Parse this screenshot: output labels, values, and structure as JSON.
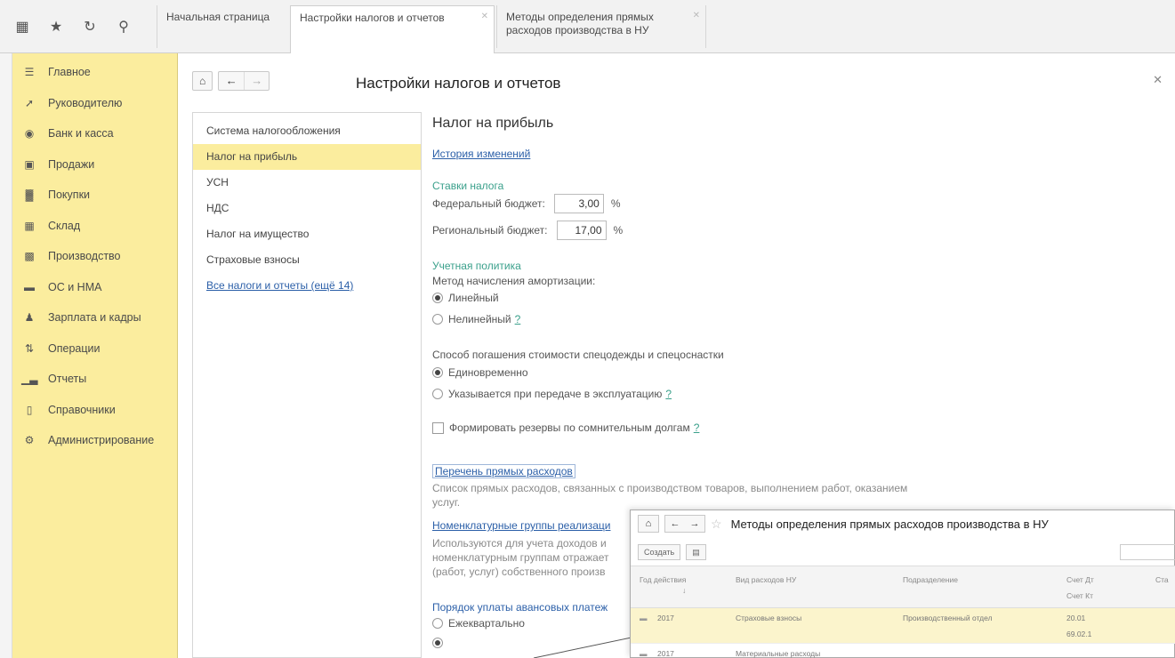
{
  "tabs": [
    {
      "label": "Начальная страница"
    },
    {
      "label": "Настройки налогов и отчетов"
    },
    {
      "label": "Методы определения прямых расходов производства в НУ"
    }
  ],
  "sidebar": {
    "items": [
      {
        "label": "Главное",
        "icon": "menu-icon"
      },
      {
        "label": "Руководителю",
        "icon": "chart-line-icon"
      },
      {
        "label": "Банк и касса",
        "icon": "coin-icon"
      },
      {
        "label": "Продажи",
        "icon": "bag-icon"
      },
      {
        "label": "Покупки",
        "icon": "cart-icon"
      },
      {
        "label": "Склад",
        "icon": "warehouse-icon"
      },
      {
        "label": "Производство",
        "icon": "factory-icon"
      },
      {
        "label": "ОС и НМА",
        "icon": "truck-icon"
      },
      {
        "label": "Зарплата и кадры",
        "icon": "person-icon"
      },
      {
        "label": "Операции",
        "icon": "operations-icon"
      },
      {
        "label": "Отчеты",
        "icon": "bar-chart-icon"
      },
      {
        "label": "Справочники",
        "icon": "book-icon"
      },
      {
        "label": "Администрирование",
        "icon": "gear-icon"
      }
    ]
  },
  "main": {
    "title": "Настройки налогов и отчетов",
    "sections": [
      {
        "label": "Система налогообложения"
      },
      {
        "label": "Налог на прибыль"
      },
      {
        "label": "УСН"
      },
      {
        "label": "НДС"
      },
      {
        "label": "Налог на имущество"
      },
      {
        "label": "Страховые взносы"
      }
    ],
    "all_taxes_link": "Все налоги и отчеты (ещё 14)"
  },
  "content": {
    "heading": "Налог на прибыль",
    "history_link": "История изменений",
    "rates_header": "Ставки налога",
    "federal_label": "Федеральный бюджет:",
    "federal_value": "3,00",
    "regional_label": "Региональный бюджет:",
    "regional_value": "17,00",
    "percent": "%",
    "policy_header": "Учетная политика",
    "depreciation_label": "Метод начисления амортизации:",
    "depreciation_linear": "Линейный",
    "depreciation_nonlinear": "Нелинейный",
    "help": "?",
    "workwear_label": "Способ погашения стоимости спецодежды и спецоснастки",
    "workwear_once": "Единовременно",
    "workwear_on_transfer": "Указывается при передаче в эксплуатацию",
    "reserves_label": "Формировать резервы по сомнительным долгам",
    "direct_costs_link": "Перечень прямых расходов",
    "direct_costs_desc_1": "Список прямых расходов, связанных с производством товаров, выполнением работ, оказанием",
    "direct_costs_desc_2": "услуг.",
    "nomenclature_link": "Номенклатурные группы реализаци",
    "nomenclature_desc_1": "Используются для учета доходов и",
    "nomenclature_desc_2": "номенклатурным группам отражает",
    "nomenclature_desc_3": "(работ, услуг) собственного произв",
    "advance_header": "Порядок уплаты авансовых платеж",
    "advance_quarterly": "Ежеквартально"
  },
  "overlay": {
    "title": "Методы определения прямых расходов производства в НУ",
    "create_button": "Создать",
    "columns": {
      "year": "Год действия",
      "expense_type": "Вид расходов НУ",
      "department": "Подразделение",
      "debit": "Счет Дт",
      "credit": "Счет Кт",
      "cut": "Ста"
    },
    "rows": [
      {
        "year": "2017",
        "expense_type": "Страховые взносы",
        "department": "Производственный отдел",
        "debit": "20.01",
        "credit": "69.02.1"
      },
      {
        "year": "2017",
        "expense_type": "Материальные расходы",
        "department": "",
        "debit": "",
        "credit": ""
      }
    ]
  }
}
